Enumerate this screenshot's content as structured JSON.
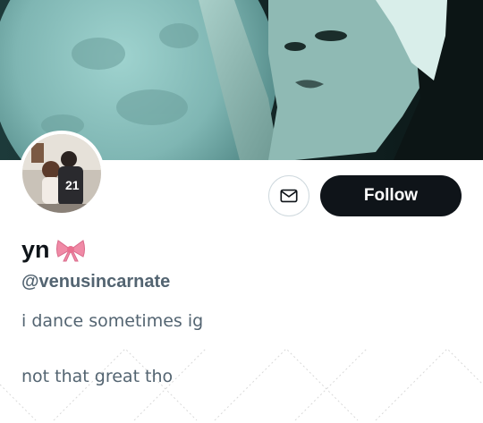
{
  "profile": {
    "display_name": "yn",
    "name_emoji": "bow-icon",
    "handle": "@venusincarnate",
    "bio_lines": [
      "i dance sometimes ig",
      "not that great tho"
    ]
  },
  "actions": {
    "follow_label": "Follow",
    "message_icon": "mail-icon"
  },
  "colors": {
    "follow_bg": "#0f1419",
    "secondary_text": "#536471",
    "primary_text": "#0f1419",
    "button_border": "#cfd9de",
    "bow": "#f08aa6"
  }
}
